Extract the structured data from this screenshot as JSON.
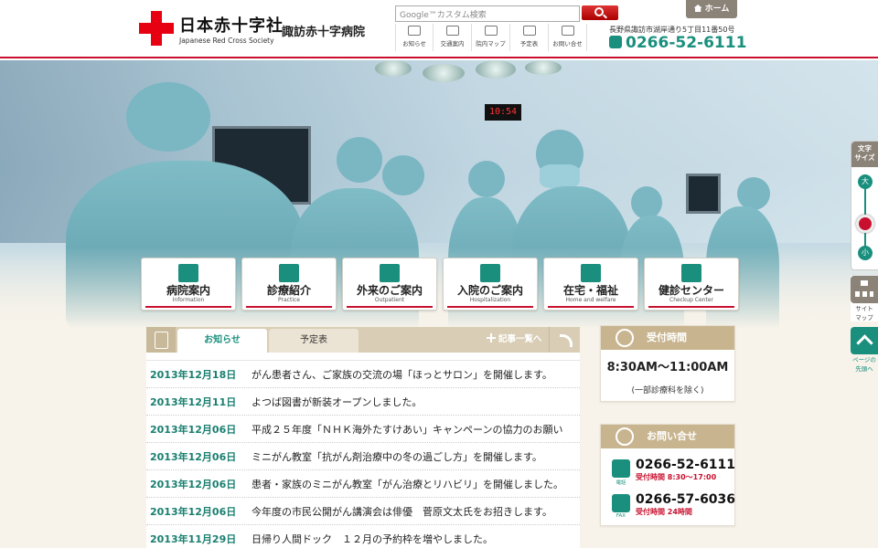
{
  "header": {
    "org_name": "日本赤十字社",
    "org_name_en": "Japanese Red Cross Society",
    "hospital_name": "諏訪赤十字病院",
    "search_placeholder": "Google™カスタム検索",
    "home_label": "ホーム",
    "address": "長野県諏訪市湖岸通り5丁目11番50号",
    "phone": "0266-52-6111",
    "util_nav": [
      {
        "label": "お知らせ",
        "icon": "notice-icon"
      },
      {
        "label": "交通案内",
        "icon": "bus-icon"
      },
      {
        "label": "院内マップ",
        "icon": "map-book-icon"
      },
      {
        "label": "予定表",
        "icon": "calendar-icon"
      },
      {
        "label": "お問い合せ",
        "icon": "mail-icon"
      }
    ]
  },
  "hero": {
    "clock_text": "10:54"
  },
  "main_nav": [
    {
      "label": "病院案内",
      "sub": "Information",
      "icon": "building-icon"
    },
    {
      "label": "診療紹介",
      "sub": "Practice",
      "icon": "stethoscope-icon"
    },
    {
      "label": "外来のご案内",
      "sub": "Outpatient",
      "icon": "consult-icon"
    },
    {
      "label": "入院のご案内",
      "sub": "Hospitalization",
      "icon": "bed-icon"
    },
    {
      "label": "在宅・福祉",
      "sub": "Home and welfare",
      "icon": "house-icon"
    },
    {
      "label": "健診センター",
      "sub": "Checkup Center",
      "icon": "syringe-icon"
    }
  ],
  "news": {
    "tab_active": "お知らせ",
    "tab_inactive": "予定表",
    "list_link": "記事一覧へ",
    "items": [
      {
        "date": "2013年12月18日",
        "title": "がん患者さん、ご家族の交流の場「ほっとサロン」を開催します。"
      },
      {
        "date": "2013年12月11日",
        "title": "よつば図書が新装オープンしました。"
      },
      {
        "date": "2013年12月06日",
        "title": "平成２５年度「ＮＨＫ海外たすけあい」キャンペーンの協力のお願い"
      },
      {
        "date": "2013年12月06日",
        "title": "ミニがん教室「抗がん剤治療中の冬の過ごし方」を開催します。"
      },
      {
        "date": "2013年12月06日",
        "title": "患者・家族のミニがん教室「がん治療とリハビリ」を開催しました。"
      },
      {
        "date": "2013年12月06日",
        "title": "今年度の市民公開がん講演会は俳優　菅原文太氏をお招きします。"
      },
      {
        "date": "2013年11月29日",
        "title": "日帰り人間ドック　１２月の予約枠を増やしました。"
      }
    ]
  },
  "hours": {
    "title": "受付時間",
    "time": "8:30AM～11:00AM",
    "note": "(一部診療科を除く)"
  },
  "contact": {
    "title": "お問い合せ",
    "tel_label": "電話",
    "tel": "0266-52-6111",
    "tel_hours": "受付時間 8:30～17:00",
    "fax_label": "FAX",
    "fax": "0266-57-6036",
    "fax_hours": "受付時間 24時間"
  },
  "tools": {
    "font_size_title_1": "文字",
    "font_size_title_2": "サイズ",
    "large": "大",
    "small": "小",
    "sitemap_1": "サイト",
    "sitemap_2": "マップ",
    "pagetop_1": "ページの",
    "pagetop_2": "先頭へ"
  },
  "colors": {
    "brand_red": "#e60012",
    "accent_teal": "#1a8f7d",
    "tan": "#c8b58f"
  }
}
